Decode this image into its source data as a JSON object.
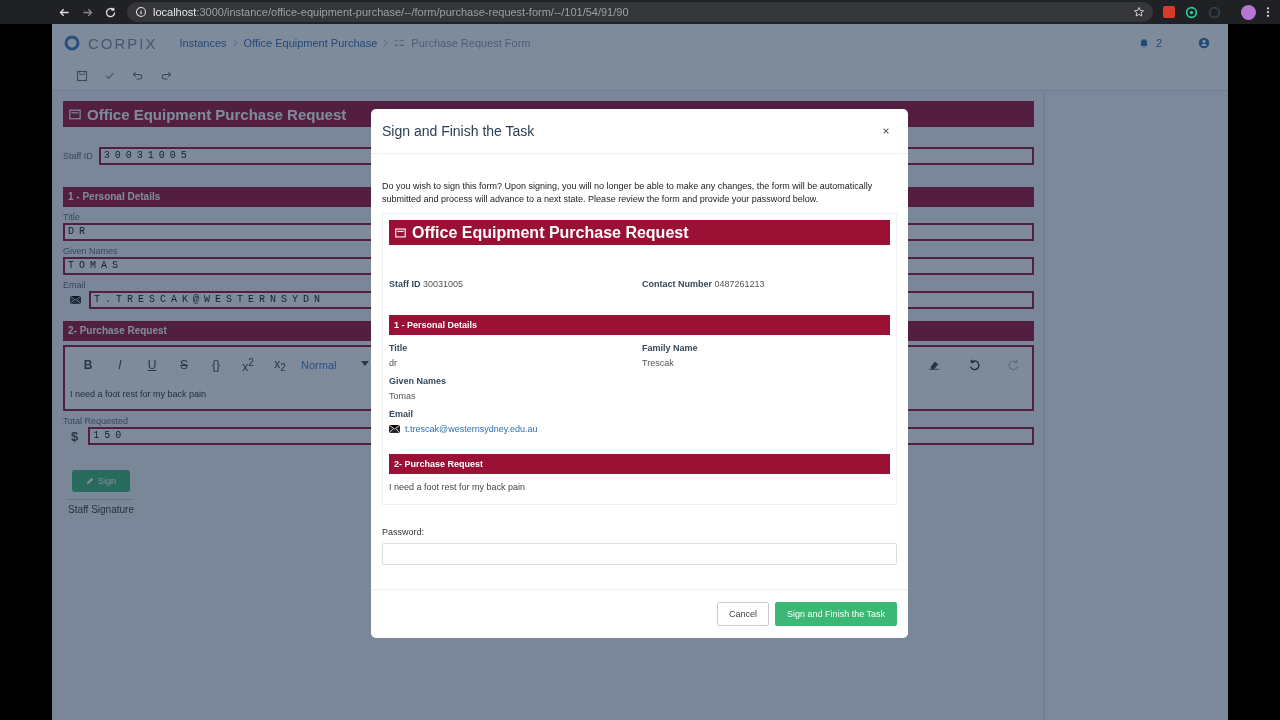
{
  "browser": {
    "url": "**localhost**:3000/instance/office-equipment-purchase/--/form/purchase-request-form/--/101/54/91/90"
  },
  "app": {
    "logo": "CORPIX",
    "breadcrumbs": [
      {
        "label": "Instances"
      },
      {
        "label": "Office Equipment Purchase"
      },
      {
        "label": "Purchase Request Form"
      }
    ],
    "notifications": "2"
  },
  "form": {
    "title": "Office Equipment Purchase Request",
    "staff_id": {
      "label": "Staff ID",
      "value": "30031005"
    },
    "sections": [
      {
        "title": "1 - Personal Details",
        "fields": [
          {
            "label": "Title",
            "value": "DR",
            "kind": "text"
          },
          {
            "label": "Given Names",
            "value": "TOMAS",
            "kind": "text"
          },
          {
            "label": "Email",
            "value": "T.TRESCAK@WESTERNSYDN",
            "kind": "email"
          }
        ]
      },
      {
        "title": "2- Purchase Request",
        "editor": {
          "tools": [
            "B",
            "I",
            "U",
            "S",
            "{}",
            "x$^{2}$",
            "x$_{2}$"
          ],
          "format": "Normal",
          "content": "I need a foot rest for my back pain"
        },
        "total": {
          "label": "Total Requested",
          "prefix": "$",
          "value": "150"
        }
      }
    ],
    "sign": {
      "button": "Sign",
      "caption": "Staff Signature"
    }
  },
  "modal": {
    "title": "Sign and Finish the Task",
    "message": "Do you wish to sign this form? Upon signing, you will no longer be able to make any changes, the form will be automatically submitted and process will advance to a next state. Please review the form and provide your password below.",
    "preview": {
      "title": "Office Equipment Purchase Request",
      "staff_id": {
        "label": "Staff ID",
        "value": "30031005"
      },
      "contact": {
        "label": "Contact Number",
        "value": "0487261213"
      },
      "sections": [
        {
          "title": "1 - Personal Details",
          "rows": [
            [
              {
                "label": "Title",
                "value": "dr",
                "kind": "text"
              },
              {
                "label": "Family Name",
                "value": "Trescak",
                "kind": "text"
              }
            ],
            [
              {
                "label": "Given Names",
                "value": "Tomas",
                "kind": "text"
              }
            ],
            [
              {
                "label": "Email",
                "value": "t.trescak@westernsydney.edu.au",
                "kind": "email"
              }
            ]
          ]
        },
        {
          "title": "2- Purchase Request",
          "text": "I need a foot rest for my back pain"
        }
      ]
    },
    "password": {
      "label": "Password:"
    },
    "buttons": [
      {
        "label": "Cancel",
        "kind": "secondary"
      },
      {
        "label": "Sign and Finish the Task",
        "kind": "primary"
      }
    ]
  }
}
